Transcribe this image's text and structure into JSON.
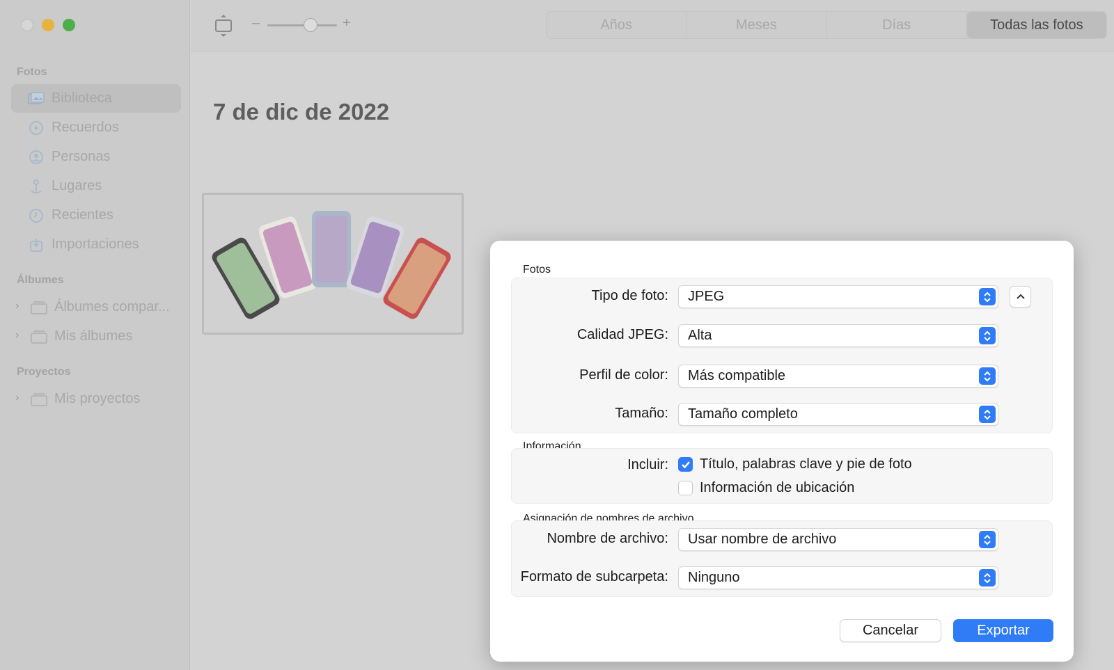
{
  "sidebar": {
    "sections": [
      {
        "title": "Fotos"
      },
      {
        "title": "Álbumes"
      },
      {
        "title": "Proyectos"
      }
    ],
    "fotos_items": [
      {
        "label": "Biblioteca",
        "icon": "photo-library-icon"
      },
      {
        "label": "Recuerdos",
        "icon": "memories-icon"
      },
      {
        "label": "Personas",
        "icon": "people-icon"
      },
      {
        "label": "Lugares",
        "icon": "places-pin-icon"
      },
      {
        "label": "Recientes",
        "icon": "clock-icon"
      },
      {
        "label": "Importaciones",
        "icon": "import-icon"
      }
    ],
    "albumes_items": [
      {
        "label": "Álbumes compar..."
      },
      {
        "label": "Mis álbumes"
      }
    ],
    "proyectos_items": [
      {
        "label": "Mis proyectos"
      }
    ]
  },
  "toolbar": {
    "slider_minus": "–",
    "slider_plus": "+",
    "tabs": [
      "Años",
      "Meses",
      "Días",
      "Todas las fotos"
    ],
    "selected_tab": "Todas las fotos"
  },
  "content": {
    "date_title": "7 de dic de 2022"
  },
  "dialog": {
    "section_fotos": "Fotos",
    "section_informacion": "Información",
    "section_nombres": "Asignación de nombres de archivo",
    "tipo_foto": {
      "label": "Tipo de foto:",
      "value": "JPEG"
    },
    "calidad": {
      "label": "Calidad JPEG:",
      "value": "Alta"
    },
    "perfil": {
      "label": "Perfil de color:",
      "value": "Más compatible"
    },
    "tamano": {
      "label": "Tamaño:",
      "value": "Tamaño completo"
    },
    "incluir_label": "Incluir:",
    "check_titulo": {
      "label": "Título, palabras clave y pie de foto",
      "checked": true
    },
    "check_ubicacion": {
      "label": "Información de ubicación",
      "checked": false
    },
    "nombre_archivo": {
      "label": "Nombre de archivo:",
      "value": "Usar nombre de archivo"
    },
    "subcarpeta": {
      "label": "Formato de subcarpeta:",
      "value": "Ninguno"
    },
    "cancel": "Cancelar",
    "export": "Exportar"
  },
  "colors": {
    "accent": "#2f7cf6"
  }
}
